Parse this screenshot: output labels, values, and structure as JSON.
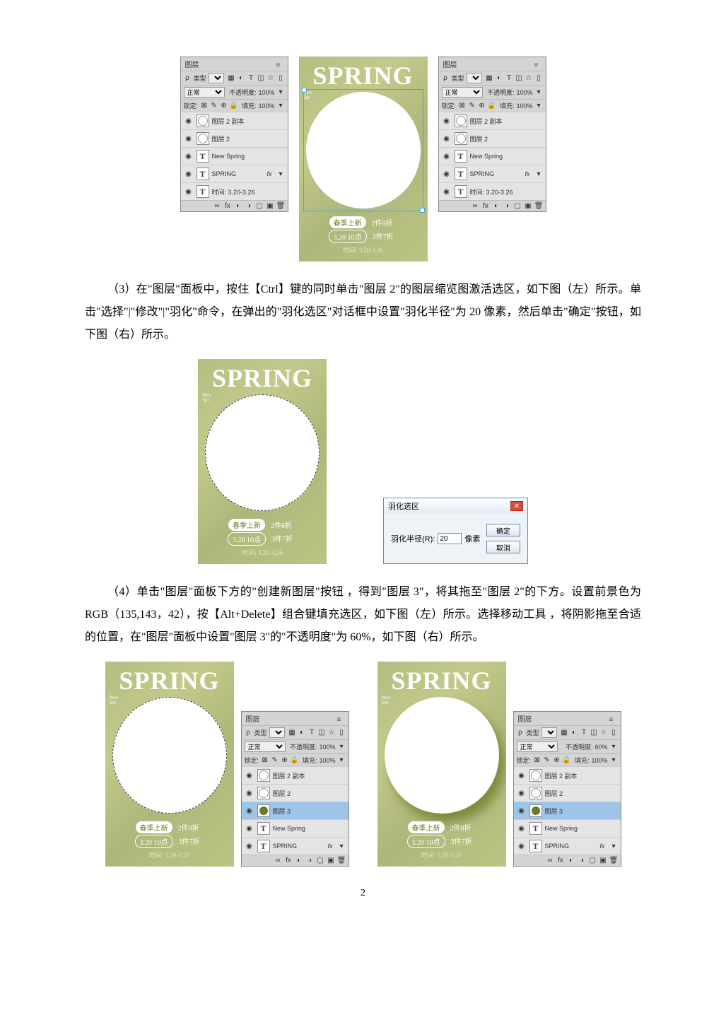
{
  "panel": {
    "tab": "图层",
    "typeLabel": "类型",
    "blendMode": "正常",
    "opacityLabel": "不透明度:",
    "opacity100": "100%",
    "opacity60": "60%",
    "lockLabel": "锁定:",
    "fillLabel": "填充:",
    "fillVal": "100%",
    "layers": {
      "layer2copy": "图层 2 副本",
      "layer2": "图层 2",
      "layer3": "图层 3",
      "newspring": "New Spring",
      "spring": "SPRING",
      "time": "时间: 3.20-3.26"
    },
    "fx": "fx",
    "footIcons": "∞  fx  ◐  ◑  ▢  ▣  🗑"
  },
  "canvas": {
    "spring": "SPRING",
    "new1": "New",
    "new2": "Spr",
    "pill1a": "春季上新",
    "pill1b": "2件8折",
    "pill2a": "3.20 10点",
    "pill2b": "3件7折",
    "timebar": "时间: 3.20-3.26"
  },
  "para3": "（3）在\"图层\"面板中，按住【Ctrl】键的同时单击\"图层 2\"的图层缩览图激活选区，如下图（左）所示。单击\"选择\"|\"修改\"|\"羽化\"命令，在弹出的\"羽化选区\"对话框中设置\"羽化半径\"为 20 像素，然后单击\"确定\"按钮，如下图（右）所示。",
  "dialog": {
    "title": "羽化选区",
    "radiusLabel": "羽化半径(R):",
    "radiusVal": "20",
    "unit": "像素",
    "ok": "确定",
    "cancel": "取消"
  },
  "para4": "（4）单击\"图层\"面板下方的\"创建新图层\"按钮  ，得到\"图层 3\"，将其拖至\"图层 2\"的下方。设置前景色为 RGB（135,143，42），按【Alt+Delete】组合键填充选区，如下图（左）所示。选择移动工具  ，将阴影拖至合适的位置，在\"图层\"面板中设置\"图层 3\"的\"不透明度\"为 60%，如下图（右）所示。",
  "pageNum": "2"
}
